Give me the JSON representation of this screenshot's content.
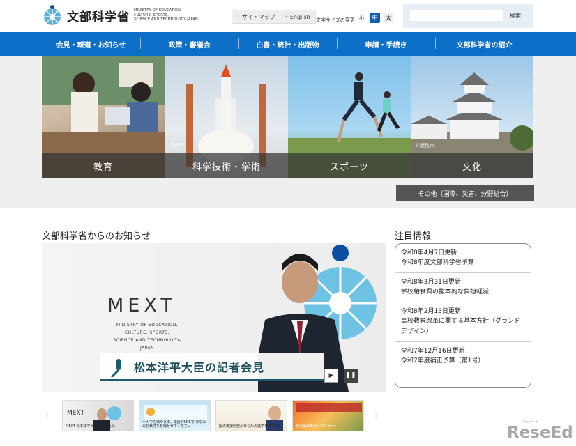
{
  "header": {
    "logo_name": "文部科学省",
    "logo_en": [
      "MINISTRY OF EDUCATION,",
      "CULTURE, SPORTS,",
      "SCIENCE AND TECHNOLOGY-JAPAN"
    ],
    "sitemap_label": "サイトマップ",
    "english_label": "English",
    "font_size_label": "文字サイズの変更",
    "font_small": "小",
    "font_mid": "中",
    "font_large": "大",
    "search_button": "検索",
    "search_value": ""
  },
  "nav": {
    "items": [
      "会見・報道・お知らせ",
      "政策・審議会",
      "白書・統計・出版物",
      "申請・手続き",
      "文部科学省の紹介"
    ]
  },
  "categories": {
    "tiles": [
      "教育",
      "科学技術・学術",
      "スポーツ",
      "文化"
    ],
    "credit_jaxa": "©JAXA",
    "credit_himeji": "©姫路市",
    "other_button": "その他（国際、災害、分野総合）"
  },
  "news": {
    "section_title": "文部科学省からのお知らせ",
    "visual_mext": "MEXT",
    "visual_sub": [
      "MINISTRY OF EDUCATION,",
      "CULTURE, SPORTS,",
      "SCIENCE AND TECHNOLOGY-JAPAN"
    ],
    "visual_caption": "松本洋平大臣の記者会見",
    "play_icon": "▶",
    "pause_icon": "❚❚"
  },
  "notice": {
    "title": "注目情報",
    "items": [
      {
        "date": "令和8年4月7日更新",
        "text": "令和8年度文部科学省予算"
      },
      {
        "date": "令和8年3月31日更新",
        "text": "学校給食費の抜本的な負担軽減"
      },
      {
        "date": "令和8年2月13日更新",
        "text": "高校教育改革に関する基本方針（グランドデザイン）"
      },
      {
        "date": "令和7年12月16日更新",
        "text": "令和7年度補正予算（第1号）"
      }
    ]
  },
  "carousel": {
    "prev": "‹",
    "next": "›",
    "thumbs": [
      "MEXT 松本洋平大臣の記者会見",
      "一人でも悩やまず、電話やSNSで あなたのお気持ちを聞かせてください",
      "国の支援制度があなたの進学をアシスト",
      "部活動改革ポータルサイト"
    ]
  },
  "watermark": {
    "main": "ReseEd",
    "sub": "リシード"
  },
  "colors": {
    "nav_blue": "#0d6fc7",
    "font_mid_active": "#0b5fb0",
    "other_button": "#555555"
  }
}
